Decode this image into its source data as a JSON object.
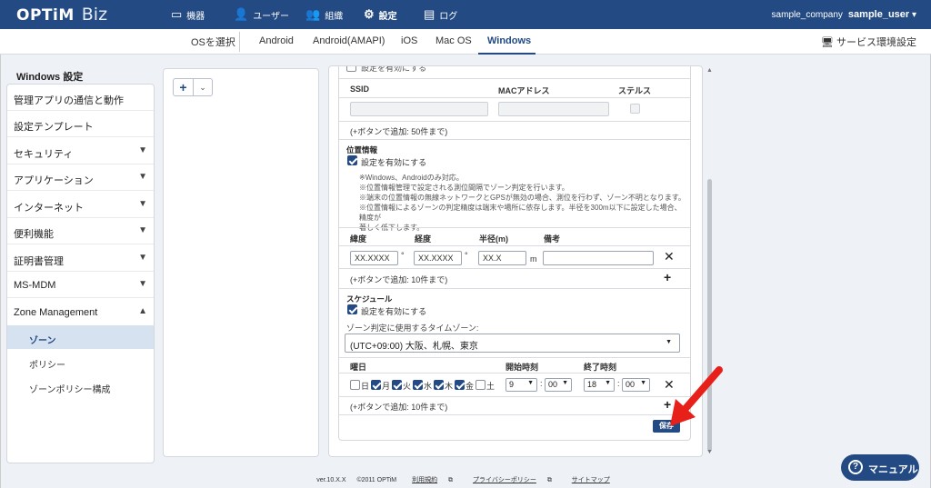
{
  "brand": {
    "logo": "OPTiM",
    "product": "Biz"
  },
  "topnav": [
    {
      "label": "機器",
      "icon": "device-icon"
    },
    {
      "label": "ユーザー",
      "icon": "user-icon"
    },
    {
      "label": "組織",
      "icon": "organization-icon"
    },
    {
      "label": "設定",
      "icon": "gear-icon",
      "active": true
    },
    {
      "label": "ログ",
      "icon": "log-icon"
    }
  ],
  "user": {
    "company": "sample_company",
    "name": "sample_user"
  },
  "os_tabs": {
    "select_label": "OSを選択",
    "tabs": [
      "Android",
      "Android(AMAPI)",
      "iOS",
      "Mac OS",
      "Windows"
    ],
    "active": "Windows"
  },
  "service_settings": "サービス環境設定",
  "sidebar": {
    "title": "Windows 設定",
    "items": [
      {
        "label": "管理アプリの通信と動作"
      },
      {
        "label": "設定テンプレート"
      },
      {
        "label": "セキュリティ",
        "chevron": "down"
      },
      {
        "label": "アプリケーション",
        "chevron": "down"
      },
      {
        "label": "インターネット",
        "chevron": "down"
      },
      {
        "label": "便利機能",
        "chevron": "down"
      },
      {
        "label": "証明書管理",
        "chevron": "down"
      },
      {
        "label": "MS-MDM",
        "chevron": "down"
      },
      {
        "label": "Zone Management",
        "chevron": "up"
      }
    ],
    "subitems": [
      {
        "label": "ゾーン",
        "active": true
      },
      {
        "label": "ポリシー"
      },
      {
        "label": "ゾーンポリシー構成"
      }
    ]
  },
  "form": {
    "top_enable_label": "設定を有効にする",
    "ssid_table": {
      "headers": [
        "SSID",
        "MACアドレス",
        "ステルス"
      ],
      "add_hint": "(+ボタンで追加: 50件まで)"
    },
    "location": {
      "title": "位置情報",
      "enable_label": "設定を有効にする",
      "enabled": true,
      "notes": [
        "※Windows、Androidのみ対応。",
        "※位置情報管理で設定される測位間隔でゾーン判定を行います。",
        "※端末の位置情報の無線ネットワークとGPSが無効の場合、測位を行わず、ゾーン不明となります。",
        "※位置情報によるゾーンの判定精度は端末や場所に依存します。半径を300m以下に設定した場合、精度が",
        "著しく低下します。"
      ],
      "headers": [
        "緯度",
        "経度",
        "半径(m)",
        "備考"
      ],
      "row": {
        "lat": "XX.XXXX",
        "lat_unit": "°",
        "lng": "XX.XXXX",
        "lng_unit": "°",
        "radius": "XX.X",
        "radius_unit": "m",
        "note": ""
      },
      "add_hint": "(+ボタンで追加: 10件まで)"
    },
    "schedule": {
      "title": "スケジュール",
      "enable_label": "設定を有効にする",
      "enabled": true,
      "timezone_label": "ゾーン判定に使用するタイムゾーン:",
      "timezone": "(UTC+09:00) 大阪、札幌、東京",
      "headers": [
        "曜日",
        "開始時刻",
        "終了時刻"
      ],
      "days": [
        {
          "label": "日",
          "checked": false
        },
        {
          "label": "月",
          "checked": true
        },
        {
          "label": "火",
          "checked": true
        },
        {
          "label": "水",
          "checked": true
        },
        {
          "label": "木",
          "checked": true
        },
        {
          "label": "金",
          "checked": true
        },
        {
          "label": "土",
          "checked": false
        }
      ],
      "start": {
        "hour": "9",
        "minute": "00"
      },
      "end": {
        "hour": "18",
        "minute": "00"
      },
      "colon": ":",
      "add_hint": "(+ボタンで追加: 10件まで)"
    },
    "save_label": "保存"
  },
  "footer": {
    "version": "ver.10.X.X",
    "copyright": "©2011 OPTiM",
    "links": [
      "利用規約",
      "プライバシーポリシー",
      "サイトマップ"
    ]
  },
  "manual_button": "マニュアル",
  "colors": {
    "brand": "#234a83",
    "annotation_arrow": "#e8201a"
  }
}
